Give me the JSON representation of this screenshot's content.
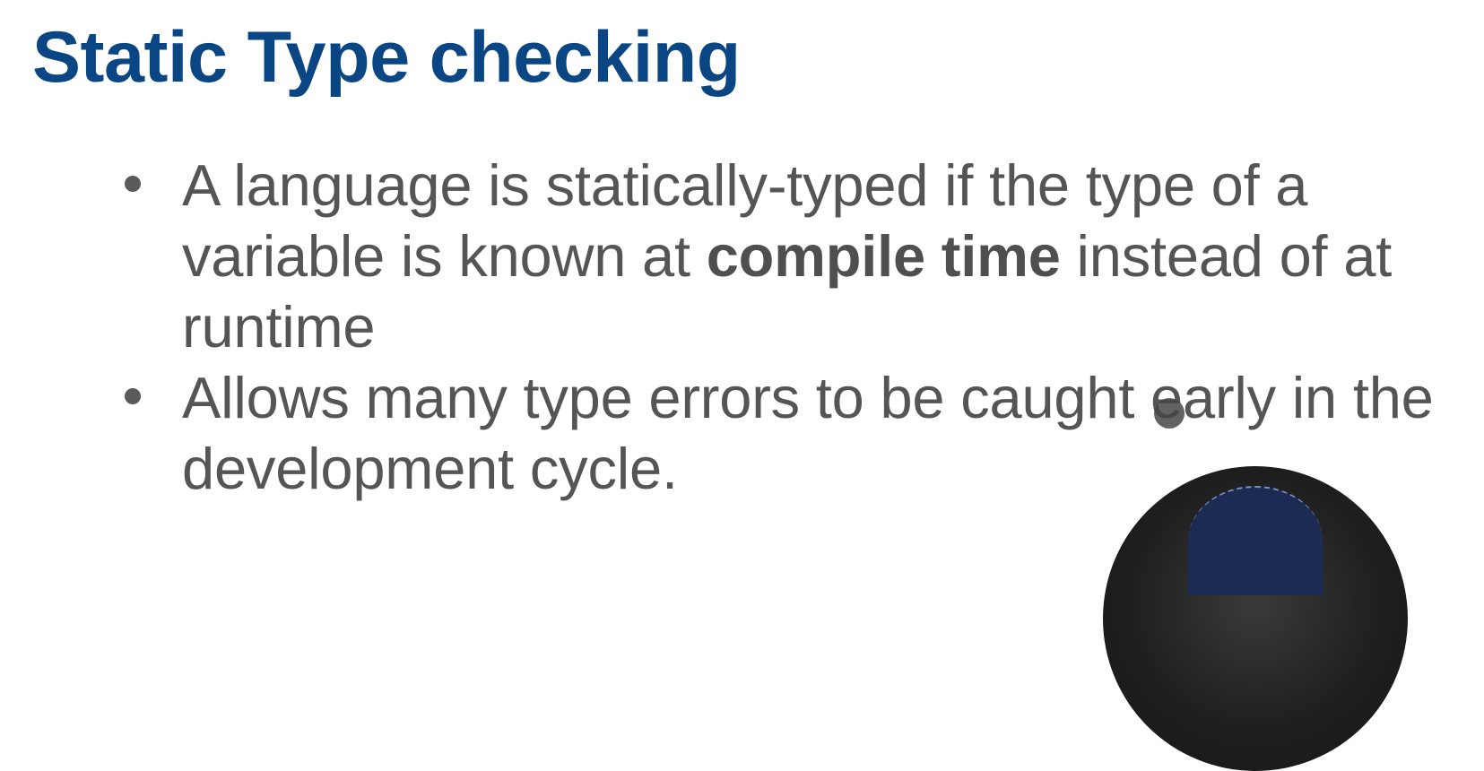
{
  "slide": {
    "title": "Static Type checking",
    "bullets": [
      {
        "before": "A language is statically-typed if the type of a variable is known at ",
        "emphasis": "compile time",
        "after": " instead of at runtime"
      },
      {
        "text": "Allows many type errors to be caught early in the development cycle."
      }
    ]
  },
  "colors": {
    "title": "#0a4683",
    "body_text": "#555555",
    "background": "#ffffff"
  },
  "icons": {
    "cursor": "text-cursor-icon",
    "webcam": "presenter-webcam"
  }
}
